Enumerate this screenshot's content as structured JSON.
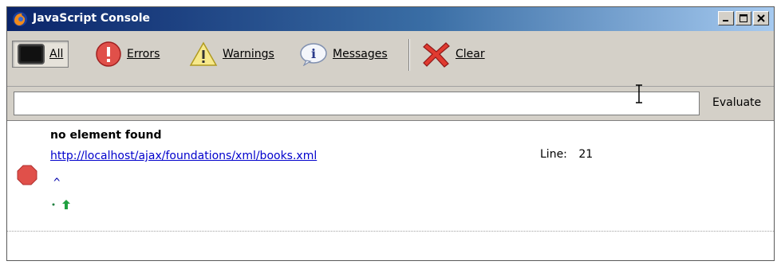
{
  "window": {
    "title": "JavaScript Console"
  },
  "toolbar": {
    "all_label": "All",
    "errors_label": "Errors",
    "warnings_label": "Warnings",
    "messages_label": "Messages",
    "clear_label": "Clear"
  },
  "eval": {
    "input_value": "",
    "button_label": "Evaluate"
  },
  "messages": [
    {
      "type": "error",
      "title": "no element found",
      "url": "http://localhost/ajax/foundations/xml/books.xml",
      "line_label": "Line:",
      "line_number": "21",
      "caret": "^"
    }
  ],
  "colors": {
    "titlebar_start": "#0a246a",
    "titlebar_end": "#a6caf0",
    "error_icon": "#e0504a",
    "link": "#0000cc"
  }
}
